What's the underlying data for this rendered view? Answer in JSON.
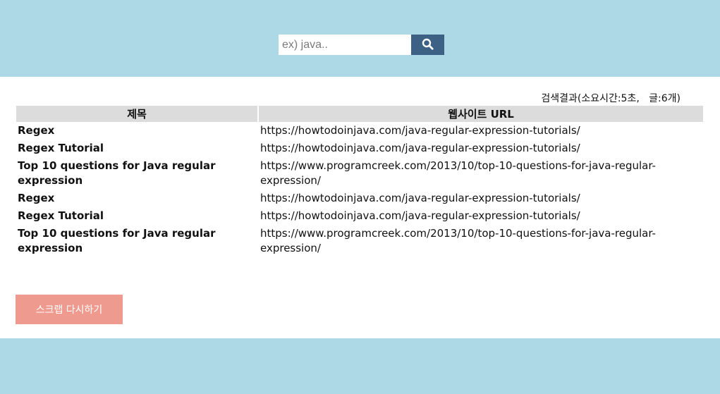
{
  "search": {
    "placeholder": "ex) java..",
    "value": "",
    "button_icon": "search-icon"
  },
  "result_info": "검색결과(소요시간:5초,   글:6개)",
  "table": {
    "headers": [
      "제목",
      "웹사이트 URL"
    ],
    "rows": [
      {
        "title": "Regex",
        "url": "https://howtodoinjava.com/java-regular-expression-tutorials/"
      },
      {
        "title": "Regex Tutorial",
        "url": "https://howtodoinjava.com/java-regular-expression-tutorials/"
      },
      {
        "title": "Top 10 questions for Java regular expression",
        "url": "https://www.programcreek.com/2013/10/top-10-questions-for-java-regular-expression/"
      },
      {
        "title": "Regex",
        "url": "https://howtodoinjava.com/java-regular-expression-tutorials/"
      },
      {
        "title": "Regex Tutorial",
        "url": "https://howtodoinjava.com/java-regular-expression-tutorials/"
      },
      {
        "title": "Top 10 questions for Java regular expression",
        "url": "https://www.programcreek.com/2013/10/top-10-questions-for-java-regular-expression/"
      }
    ]
  },
  "rescrap_button": "스크랩 다시하기",
  "colors": {
    "background": "#add8e6",
    "search_button": "#3d6184",
    "header_row": "#dcdcdc",
    "rescrap_button": "#ee9a8e"
  }
}
